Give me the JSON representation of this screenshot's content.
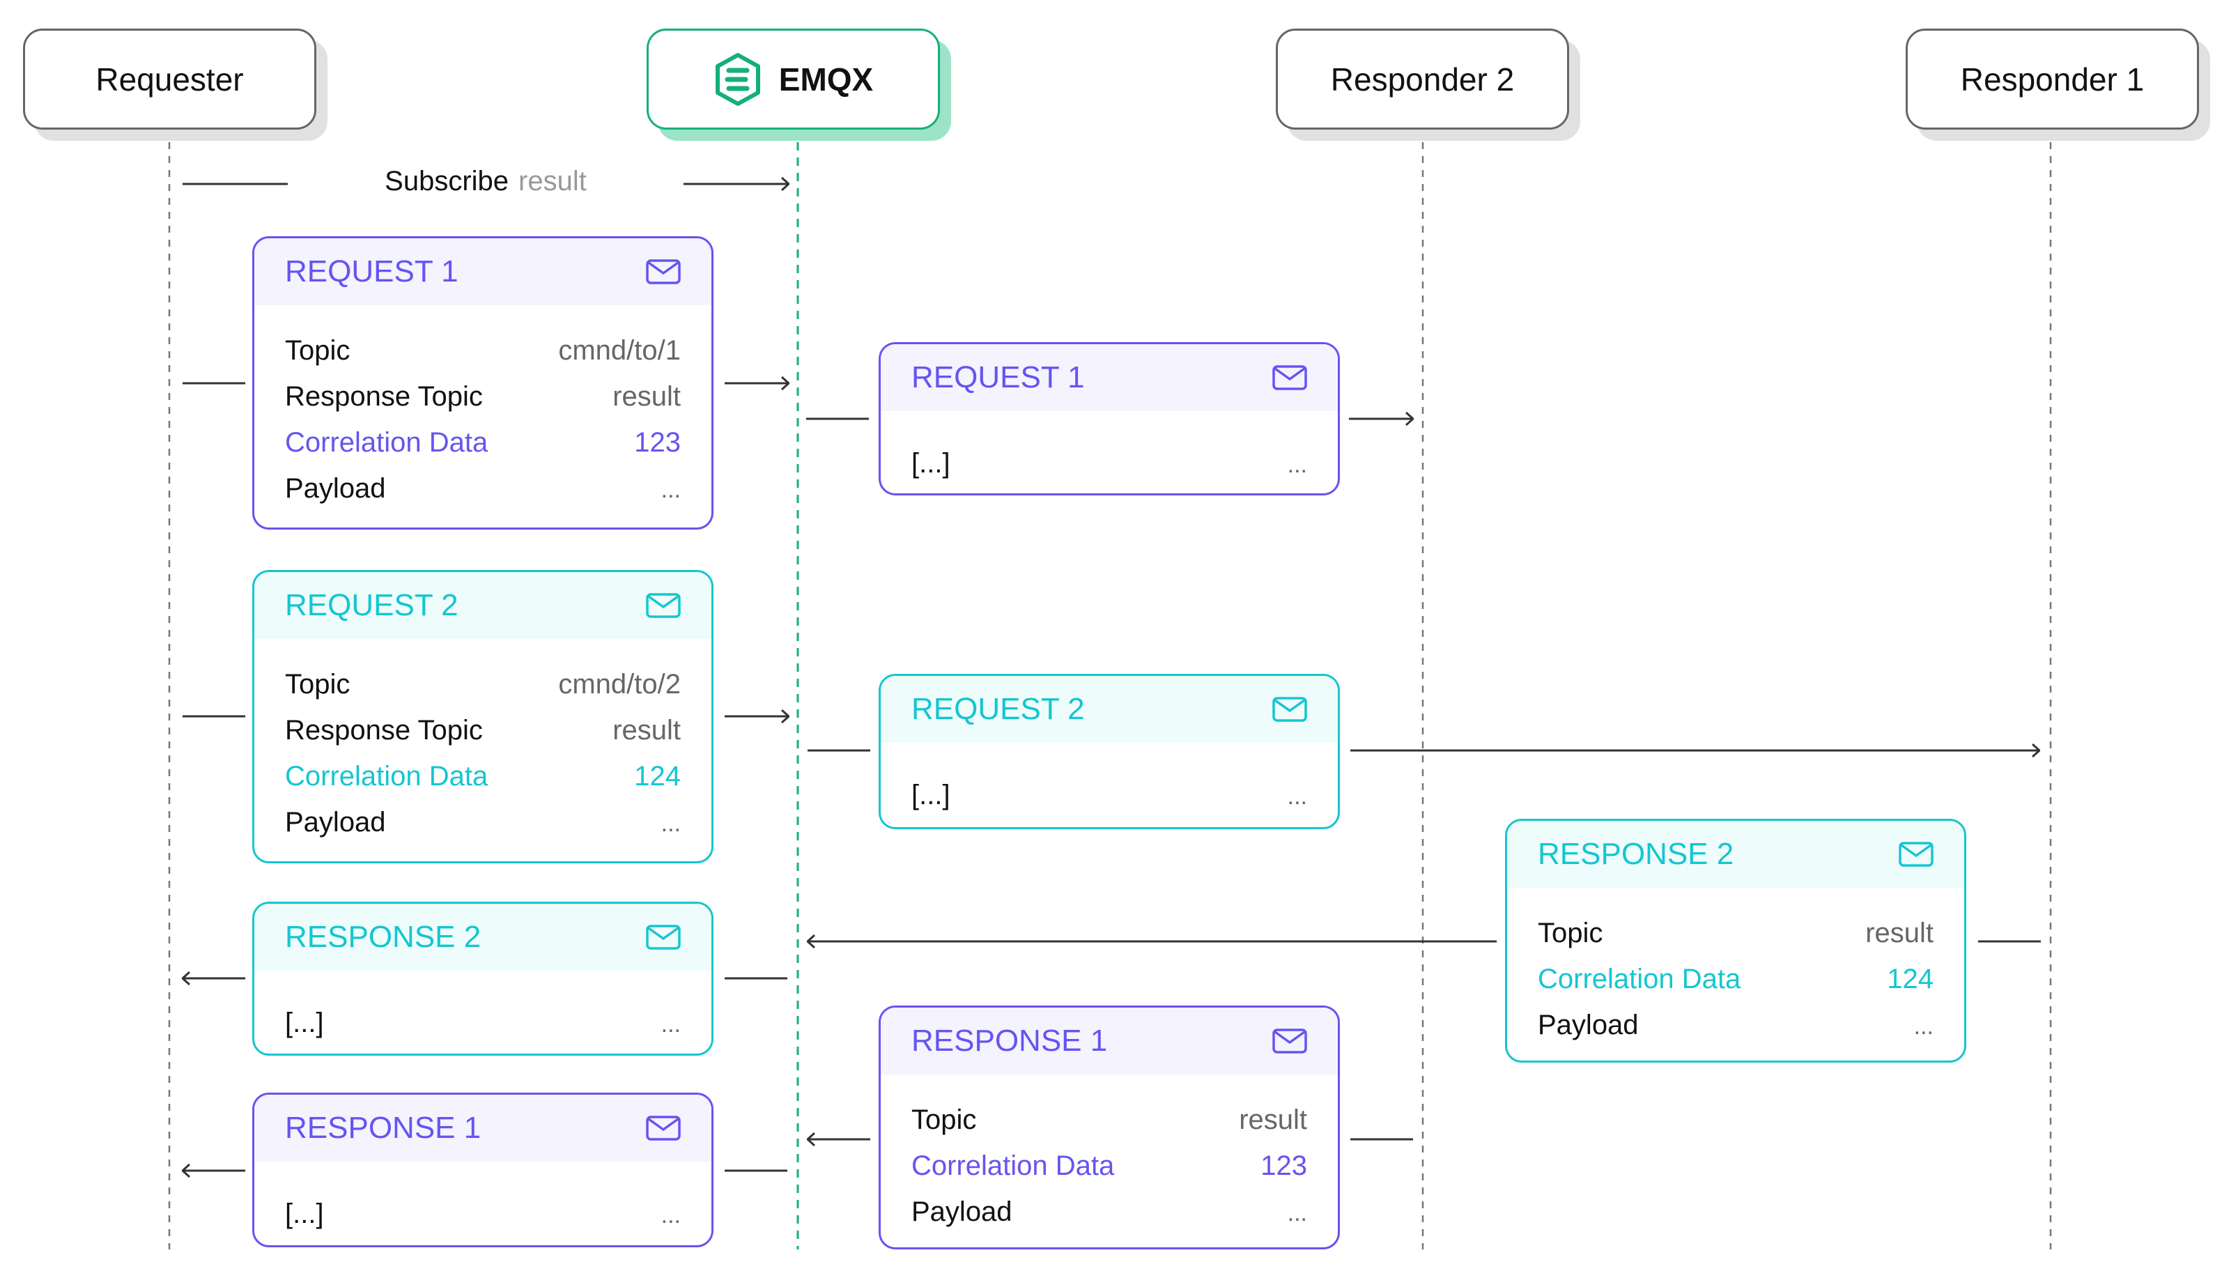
{
  "actors": {
    "requester": "Requester",
    "emqx": "EMQX",
    "responder2": "Responder 2",
    "responder1": "Responder 1"
  },
  "subscribe": {
    "label": "Subscribe",
    "topic": "result"
  },
  "colors": {
    "purple": "#6654f0",
    "teal": "#14c6d0",
    "emqx_green": "#14b07a"
  },
  "labels": {
    "topic": "Topic",
    "response_topic": "Response Topic",
    "correlation_data": "Correlation Data",
    "payload": "Payload",
    "ellipsis_bracket": "[...]",
    "ellipsis": "..."
  },
  "messages": {
    "request1_full": {
      "title": "REQUEST 1",
      "topic": "cmnd/to/1",
      "response_topic": "result",
      "correlation_data": "123",
      "payload": "..."
    },
    "request2_full": {
      "title": "REQUEST 2",
      "topic": "cmnd/to/2",
      "response_topic": "result",
      "correlation_data": "124",
      "payload": "..."
    },
    "response2_left": {
      "title": "RESPONSE 2",
      "body": "[...]",
      "trailing": "..."
    },
    "response1_left": {
      "title": "RESPONSE 1",
      "body": "[...]",
      "trailing": "..."
    },
    "request1_mid": {
      "title": "REQUEST 1",
      "body": "[...]",
      "trailing": "..."
    },
    "request2_mid": {
      "title": "REQUEST 2",
      "body": "[...]",
      "trailing": "..."
    },
    "response1_full": {
      "title": "RESPONSE 1",
      "topic": "result",
      "correlation_data": "123",
      "payload": "..."
    },
    "response2_full": {
      "title": "RESPONSE 2",
      "topic": "result",
      "correlation_data": "124",
      "payload": "..."
    }
  }
}
